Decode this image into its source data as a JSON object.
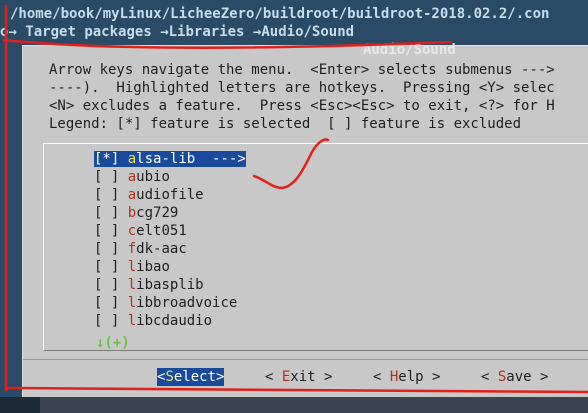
{
  "terminal": {
    "path": "/home/book/myLinux/LicheeZero/buildroot/buildroot-2018.02.2/.con",
    "breadcrumb": [
      {
        "label": "o"
      },
      {
        "label": "Target packages"
      },
      {
        "label": "Libraries"
      },
      {
        "label": "Audio/Sound"
      }
    ],
    "arrow_glyph": "→"
  },
  "dialog": {
    "title": "Audio/Sound",
    "help_lines": [
      "Arrow keys navigate the menu.  <Enter> selects submenus --->",
      "----).  Highlighted letters are hotkeys.  Pressing <Y> selec",
      "<N> excludes a feature.  Press <Esc><Esc> to exit, <?> for H",
      "Legend: [*] feature is selected  [ ] feature is excluded"
    ],
    "items": [
      {
        "check": "[*]",
        "hotkey": "a",
        "rest": "lsa-lib  --->",
        "selected": true
      },
      {
        "check": "[ ]",
        "hotkey": "a",
        "rest": "ubio",
        "selected": false
      },
      {
        "check": "[ ]",
        "hotkey": "a",
        "rest": "udiofile",
        "selected": false
      },
      {
        "check": "[ ]",
        "hotkey": "b",
        "rest": "cg729",
        "selected": false
      },
      {
        "check": "[ ]",
        "hotkey": "c",
        "rest": "elt051",
        "selected": false
      },
      {
        "check": "[ ]",
        "hotkey": "f",
        "rest": "dk-aac",
        "selected": false
      },
      {
        "check": "[ ]",
        "hotkey": "l",
        "rest": "ibao",
        "selected": false
      },
      {
        "check": "[ ]",
        "hotkey": "l",
        "rest": "ibasplib",
        "selected": false
      },
      {
        "check": "[ ]",
        "hotkey": "l",
        "rest": "ibbroadvoice",
        "selected": false
      },
      {
        "check": "[ ]",
        "hotkey": "l",
        "rest": "ibcdaudio",
        "selected": false
      }
    ],
    "more_indicator": "↓(+)",
    "buttons": [
      {
        "pre": "<",
        "hotkey": "S",
        "post": "elect>",
        "active": true
      },
      {
        "pre": "< ",
        "hotkey": "E",
        "post": "xit >",
        "active": false
      },
      {
        "pre": "< ",
        "hotkey": "H",
        "post": "elp >",
        "active": false
      },
      {
        "pre": "< ",
        "hotkey": "S",
        "post": "ave >",
        "active": false
      }
    ]
  },
  "colors": {
    "terminal_bg": "#2a4a66",
    "dialog_bg": "#c8c8c8",
    "selection_bg": "#1a4a9c",
    "hotkey": "#b03020",
    "annotation": "#e0201a"
  }
}
